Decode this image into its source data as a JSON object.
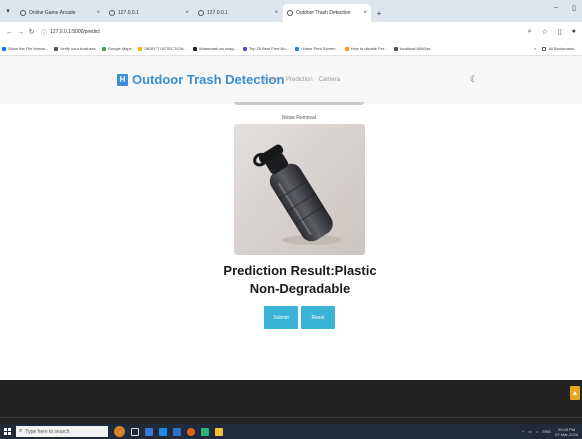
{
  "browser": {
    "tabs": [
      {
        "title": "Online Game Arcade",
        "active": false
      },
      {
        "title": "127.0.0.1",
        "active": false
      },
      {
        "title": "127.0.0.1",
        "active": false
      },
      {
        "title": "Outdoor Trash Detection",
        "active": true
      }
    ],
    "new_tab": "+",
    "url": "127.0.0.1:5000/predict",
    "bookmarks": [
      {
        "label": "Show the File format...",
        "color": "#1a73e8"
      },
      {
        "label": "Verify your business",
        "color": "#555555"
      },
      {
        "label": "Google Maps",
        "color": "#34a853"
      },
      {
        "label": "OBJECT DETECTION...",
        "color": "#f4b400"
      },
      {
        "label": "Watermark an imag...",
        "color": "#222222"
      },
      {
        "label": "Top 25 Best Free Bo...",
        "color": "#5f4bb6"
      },
      {
        "label": "I Have Print Screen...",
        "color": "#1e88e5"
      },
      {
        "label": "How to disable Pro...",
        "color": "#ff9800"
      },
      {
        "label": "localhost:5000/pr...",
        "color": "#555555"
      }
    ],
    "all_bookmarks": "All Bookmarks"
  },
  "site": {
    "brand_icon": "H",
    "brand": "Outdoor Trash Detection",
    "nav": [
      "Home",
      "Prediction",
      "Camera"
    ],
    "theme_icon": "moon-icon"
  },
  "main": {
    "caption": "Noise Removal",
    "result_line1": "Prediction Result:Plastic",
    "result_line2": "Non-Degradable",
    "submit_label": "Submit",
    "reset_label": "Reset"
  },
  "taskbar": {
    "search_placeholder": "Type here to search",
    "lang": "ENG",
    "time": "09:25 PM",
    "date": "07-Mar-2024"
  },
  "colors": {
    "brand": "#3a8fd6",
    "button": "#3ab3d7",
    "footer": "#232323",
    "scroll_top": "#e6a81c"
  }
}
